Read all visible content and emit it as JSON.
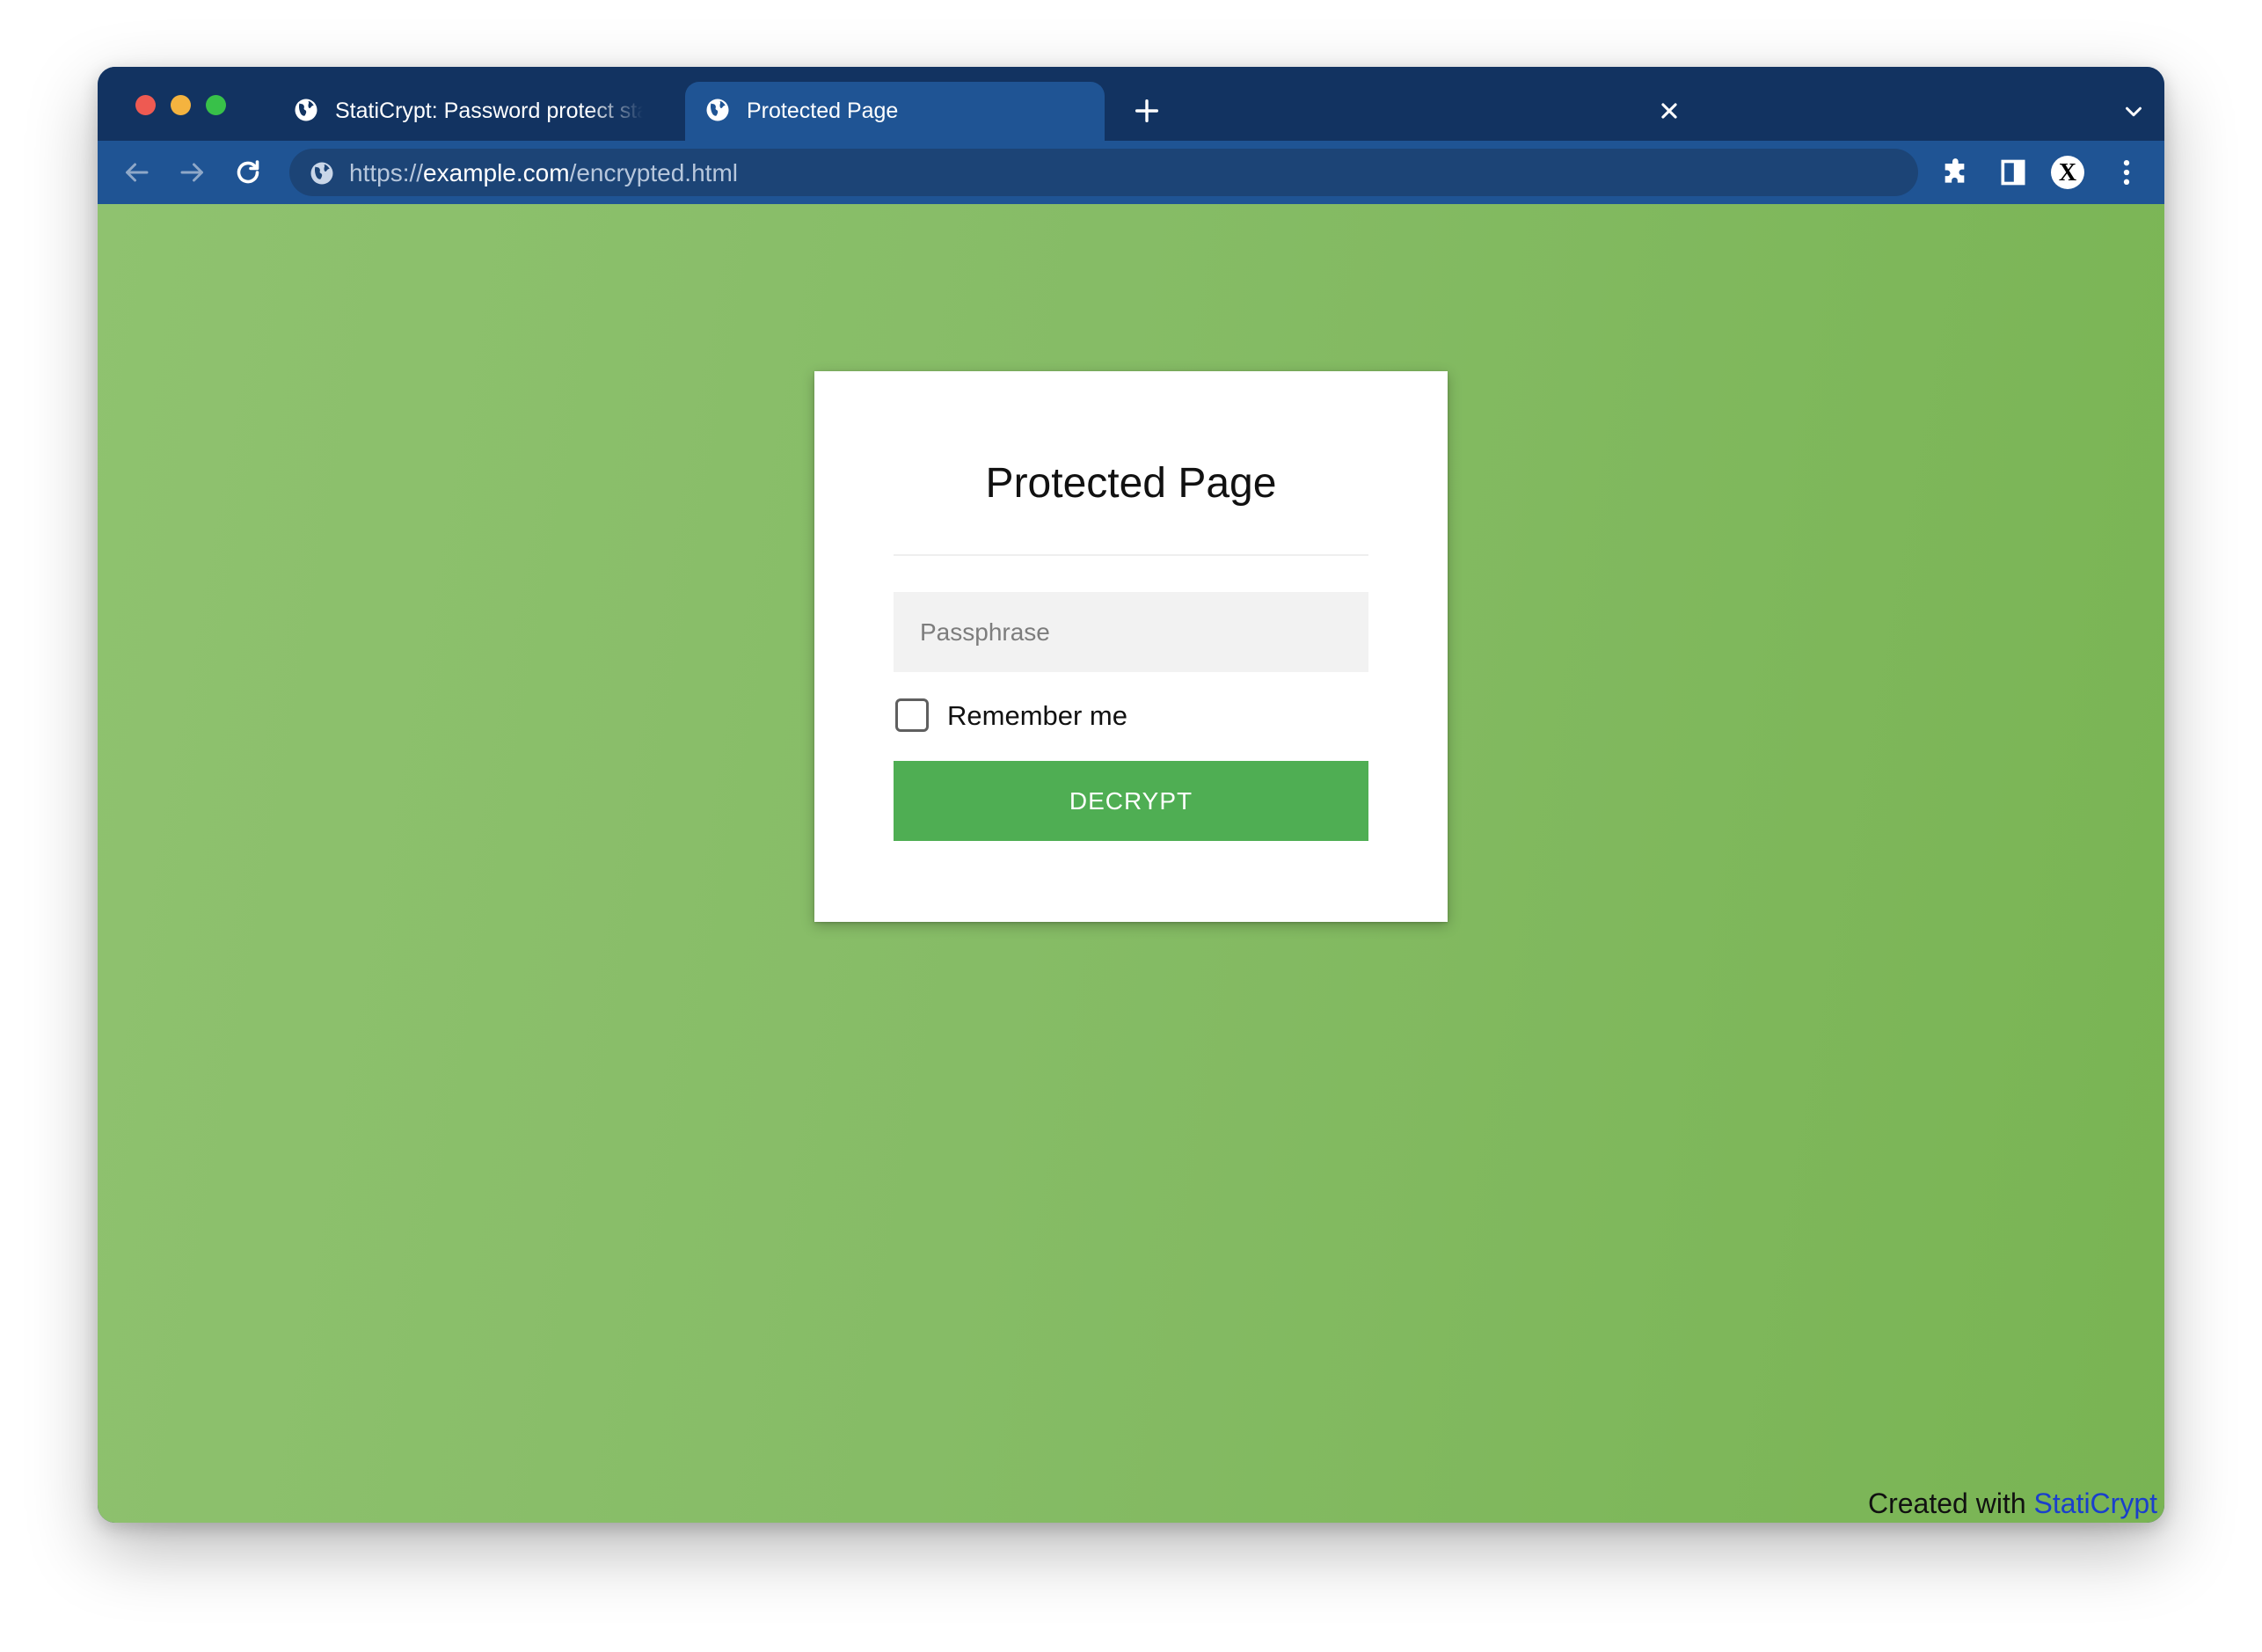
{
  "window": {
    "traffic_lights": [
      "close",
      "minimize",
      "zoom"
    ]
  },
  "tabs": [
    {
      "title": "StatiCrypt: Password protect static HTML",
      "active": false,
      "icon": "globe-icon"
    },
    {
      "title": "Protected Page",
      "active": true,
      "icon": "globe-icon"
    }
  ],
  "toolbar": {
    "url_scheme": "https://",
    "url_host": "example.com",
    "url_path": "/encrypted.html",
    "icons": [
      "back-arrow-icon",
      "forward-arrow-icon",
      "reload-icon",
      "extensions-puzzle-icon",
      "side-panel-icon",
      "profile-avatar-icon",
      "kebab-menu-icon"
    ],
    "profile_letter": "X"
  },
  "page": {
    "title": "Protected Page",
    "passphrase_placeholder": "Passphrase",
    "passphrase_value": "",
    "remember_label": "Remember me",
    "remember_checked": false,
    "decrypt_label": "DECRYPT",
    "footer_prefix": "Created with ",
    "footer_link": "StatiCrypt"
  },
  "colors": {
    "tabstrip": "#123361",
    "toolbar": "#1f5494",
    "background_green": "#86bc66",
    "button_green": "#4fae53",
    "link_blue": "#1a3fcc"
  }
}
